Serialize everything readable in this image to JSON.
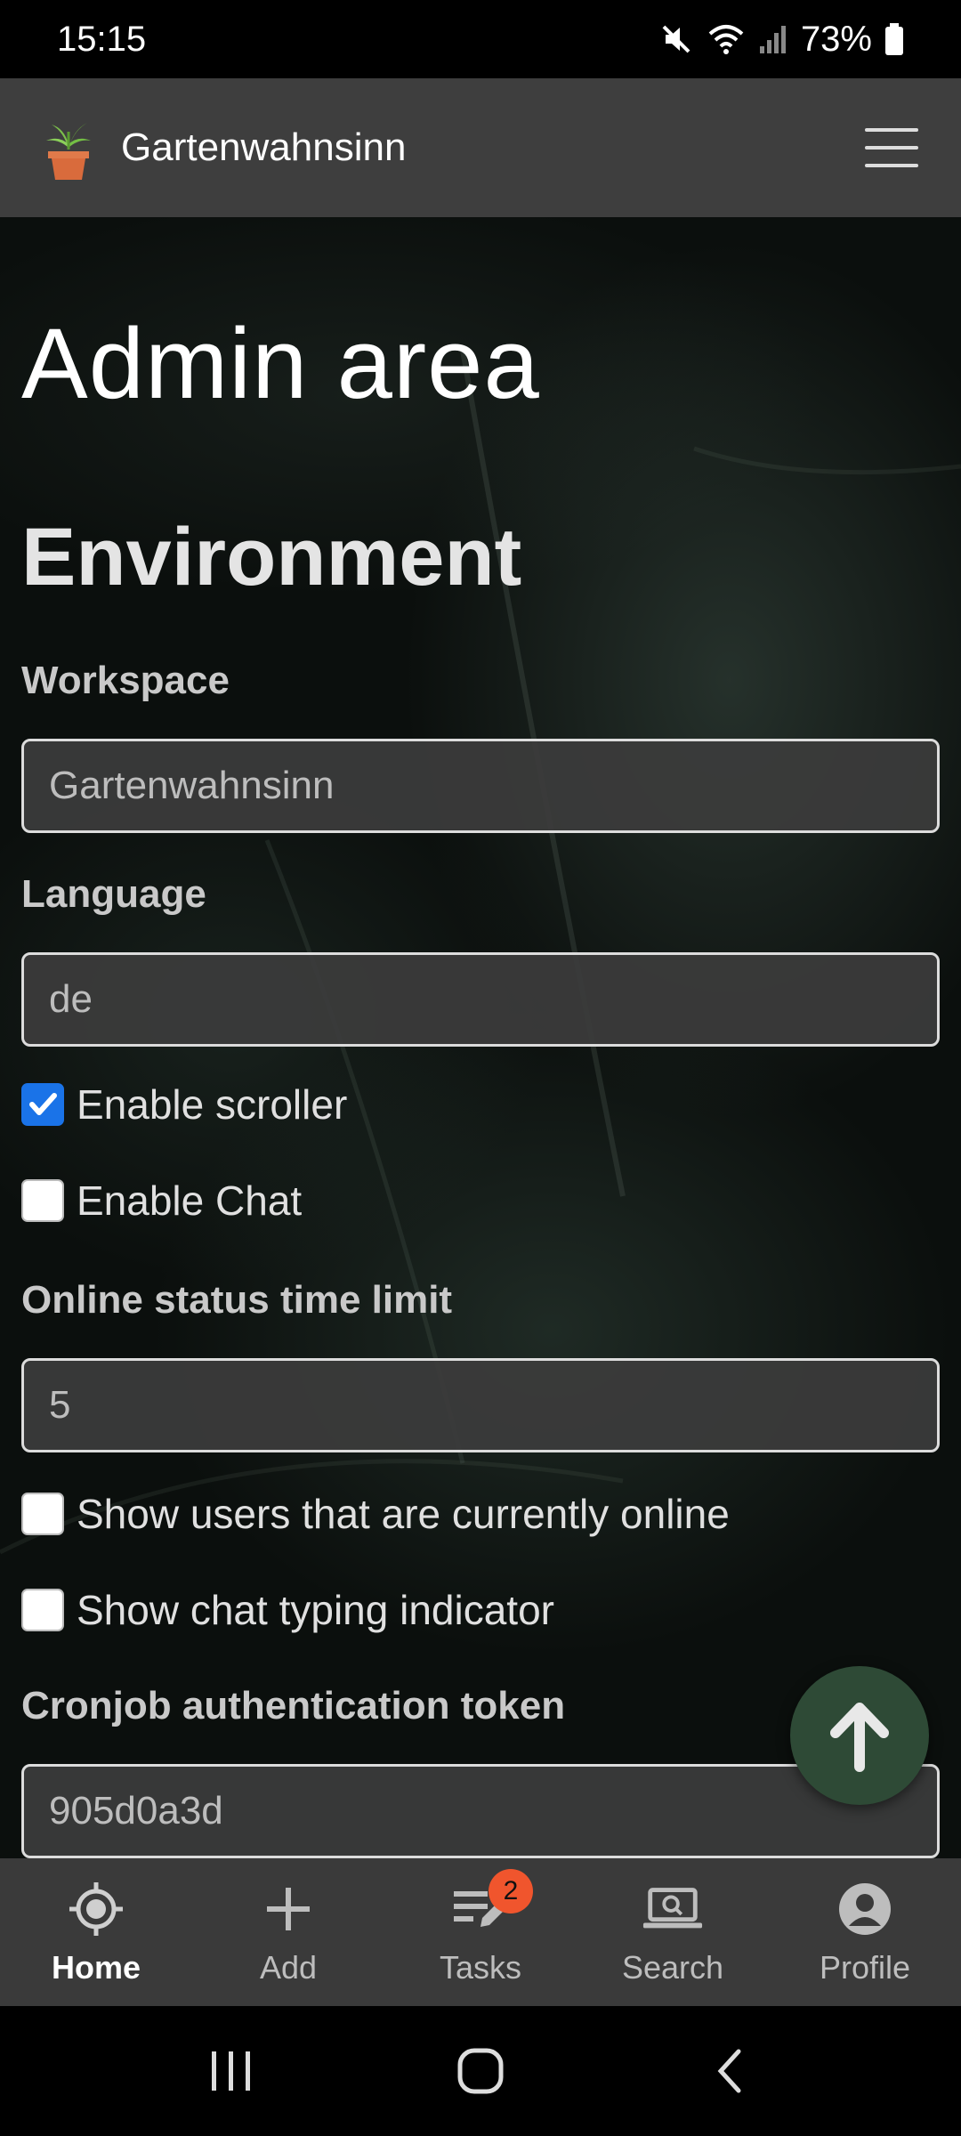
{
  "status_bar": {
    "time": "15:15",
    "battery": "73%",
    "icons": [
      "mute-icon",
      "wifi-icon",
      "signal-icon",
      "battery-icon"
    ]
  },
  "header": {
    "title": "Gartenwahnsinn",
    "logo_icon": "potted-plant-icon",
    "menu_icon": "hamburger-menu-icon"
  },
  "page": {
    "title": "Admin area",
    "section_title": "Environment",
    "fields": {
      "workspace": {
        "label": "Workspace",
        "value": "Gartenwahnsinn"
      },
      "language": {
        "label": "Language",
        "value": "de"
      },
      "online_limit": {
        "label": "Online status time limit",
        "value": "5"
      },
      "cron_token": {
        "label": "Cronjob authentication token",
        "value": "905d0a3d"
      }
    },
    "checkboxes": {
      "scroller": {
        "label": "Enable scroller",
        "checked": true
      },
      "chat": {
        "label": "Enable Chat",
        "checked": false
      },
      "show_online": {
        "label": "Show users that are currently online",
        "checked": false
      },
      "typing": {
        "label": "Show chat typing indicator",
        "checked": false
      }
    }
  },
  "fab": {
    "icon": "arrow-up-icon",
    "color": "#2e4a36"
  },
  "bottom_nav": {
    "items": [
      {
        "label": "Home",
        "icon": "crosshair-icon",
        "active": true
      },
      {
        "label": "Add",
        "icon": "plus-icon",
        "active": false
      },
      {
        "label": "Tasks",
        "icon": "tasks-edit-icon",
        "active": false,
        "badge": "2"
      },
      {
        "label": "Search",
        "icon": "laptop-search-icon",
        "active": false
      },
      {
        "label": "Profile",
        "icon": "user-circle-icon",
        "active": false
      }
    ]
  },
  "colors": {
    "accent_checkbox": "#1a73e8",
    "badge": "#f0552d",
    "header_bg": "#3e3e3e",
    "nav_bg": "#3a3a3a"
  }
}
